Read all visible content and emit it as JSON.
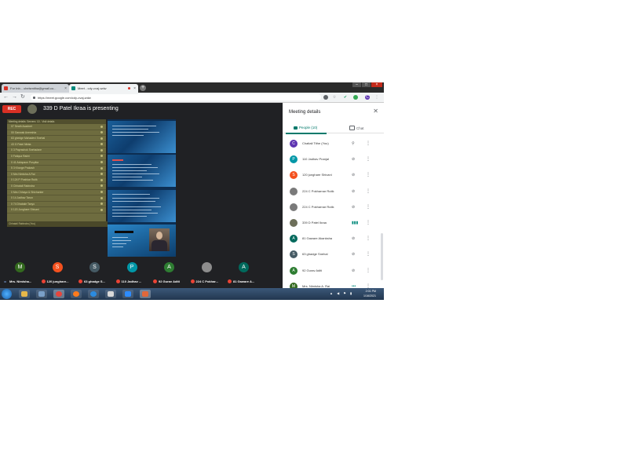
{
  "browser": {
    "tabs": [
      {
        "title": "For Inb... chelsmitha@gmail.co...",
        "active": false
      },
      {
        "title": "Meet - cdy-cvaj-wdw",
        "active": true
      }
    ],
    "url": "https://meet.google.com/cdy-cvaj-wdw"
  },
  "meet": {
    "rec_label": "REC",
    "presenting_text": "339 D Patel Ikraa is presenting",
    "shared_screen": {
      "header": "Meeting details: Servers: 10 - Visit details",
      "rows": [
        "07 Seath Acadnet",
        "00 Ganwak Aneeshta",
        "63 ghedge Mahadevi Snehal",
        "43 G Patel Nikita",
        "0 3 Payrashok Sneha/ane",
        "0 Fatiqua Rakhi",
        "0 41 Adrapaon Puspika",
        "5 3 Kharge Prakash",
        "0 Mrs Nimisha A Rai",
        "0 124 P Poshkar Rutik",
        "0 Chhatali Rabindra",
        "0 Mrs Chhaya & Shivhanter",
        "0 14 Jadhav Tarun",
        "0 74 Dhabale Tanyo",
        "0 120 Junghare Shivani"
      ],
      "footer": "Chhatali Rabindra (You)"
    },
    "slides": [
      {
        "heading": "BUTTON AND RELATED CONTENT"
      },
      {
        "heading": "SCOPE"
      },
      {
        "heading": "BY WE ARE NOW PRESENT"
      },
      {
        "heading": "DIGITAL EHR"
      }
    ],
    "tiles": [
      {
        "initial": "M",
        "label": "Mrs. Nimisha...",
        "color": "#33691e",
        "muted": false
      },
      {
        "initial": "S",
        "label": "120 junghare...",
        "color": "#f4511e",
        "muted": true
      },
      {
        "initial": "S",
        "label": "63 ghadge S...",
        "color": "#455a64",
        "muted": true
      },
      {
        "initial": "P",
        "label": "110 Jadhav ...",
        "color": "#0097a7",
        "muted": true
      },
      {
        "initial": "A",
        "label": "92 Gurav Aditi",
        "color": "#2e7d32",
        "muted": true
      },
      {
        "initial": "",
        "label": "224 C Pokhar...",
        "color": "#8d8d8d",
        "muted": true
      },
      {
        "initial": "A",
        "label": "81 Gaware A...",
        "color": "#00695c",
        "muted": true
      }
    ]
  },
  "panel": {
    "title": "Meeting details",
    "people_tab": "People (10)",
    "chat_tab": "Chat",
    "participants": [
      {
        "initial": "C",
        "name": "Chaitali Tithe (You)",
        "color": "#5e35b1",
        "status": "pin"
      },
      {
        "initial": "P",
        "name": "110 Jadhav Pranjal",
        "color": "#0097a7",
        "status": "muted"
      },
      {
        "initial": "S",
        "name": "120 junghare Shivani",
        "color": "#f4511e",
        "status": "muted"
      },
      {
        "initial": "",
        "name": "224 C Pokharnar Rutik",
        "color": "#7a7a7a",
        "status": "muted"
      },
      {
        "initial": "",
        "name": "224 C Pokharnar Rutik",
        "color": "#7a7a7a",
        "status": "muted"
      },
      {
        "initial": "",
        "name": "339 D Patel Ikraa",
        "color": "#6d6f5a",
        "status": "speaking"
      },
      {
        "initial": "A",
        "name": "81 Gaware Akanksha",
        "color": "#00695c",
        "status": "muted"
      },
      {
        "initial": "S",
        "name": "63 ghadge Snehal",
        "color": "#455a64",
        "status": "muted"
      },
      {
        "initial": "A",
        "name": "92 Gurav Aditi",
        "color": "#2e7d32",
        "status": "muted"
      },
      {
        "initial": "M",
        "name": "Mrs. Nimisha A. Rai",
        "color": "#33691e",
        "status": "dots"
      }
    ]
  },
  "taskbar": {
    "time": "2:01 PM",
    "date": "1/16/2021"
  }
}
